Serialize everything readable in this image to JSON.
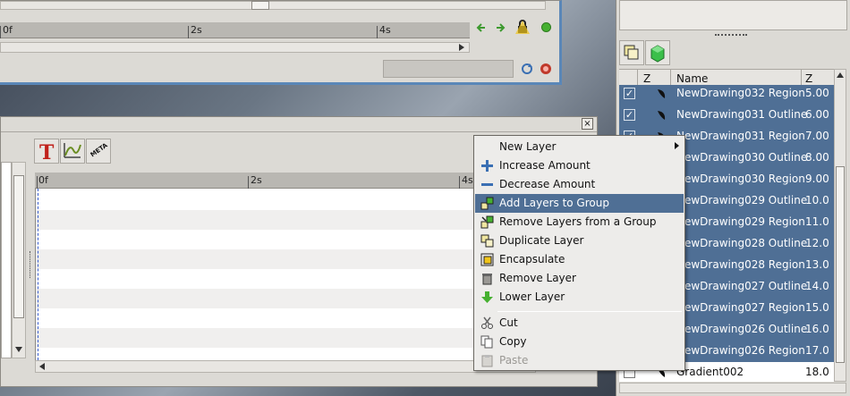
{
  "top_timetrack": {
    "ruler_labels": [
      "0f",
      "2s",
      "4s"
    ]
  },
  "params_timeline": {
    "ruler_labels": [
      "0f",
      "2s",
      "4s"
    ],
    "toolbar_meta_label": "META"
  },
  "layers_panel": {
    "columns": {
      "z": "Z",
      "name": "Name",
      "z_depth": "Z"
    },
    "rows": [
      {
        "name": "NewDrawing032 Region",
        "z": "5.00",
        "checked": true,
        "selected": true
      },
      {
        "name": "NewDrawing031 Outline",
        "z": "6.00",
        "checked": true,
        "selected": true
      },
      {
        "name": "NewDrawing031 Region",
        "z": "7.00",
        "checked": true,
        "selected": true
      },
      {
        "name": "NewDrawing030 Outline",
        "z": "8.00",
        "checked": true,
        "selected": true
      },
      {
        "name": "NewDrawing030 Region",
        "z": "9.00",
        "checked": true,
        "selected": true
      },
      {
        "name": "NewDrawing029 Outline",
        "z": "10.0",
        "checked": true,
        "selected": true
      },
      {
        "name": "NewDrawing029 Region",
        "z": "11.0",
        "checked": true,
        "selected": true
      },
      {
        "name": "NewDrawing028 Outline",
        "z": "12.0",
        "checked": true,
        "selected": true
      },
      {
        "name": "NewDrawing028 Region",
        "z": "13.0",
        "checked": true,
        "selected": true
      },
      {
        "name": "NewDrawing027 Outline",
        "z": "14.0",
        "checked": true,
        "selected": true
      },
      {
        "name": "NewDrawing027 Region",
        "z": "15.0",
        "checked": true,
        "selected": true
      },
      {
        "name": "NewDrawing026 Outline",
        "z": "16.0",
        "checked": true,
        "selected": true
      },
      {
        "name": "NewDrawing026 Region",
        "z": "17.0",
        "checked": true,
        "selected": true
      },
      {
        "name": "Gradient002",
        "z": "18.0",
        "checked": true,
        "selected": false
      }
    ]
  },
  "context_menu": {
    "items": [
      {
        "label": "New Layer",
        "icon": "none",
        "has_submenu": true
      },
      {
        "label": "Increase Amount",
        "icon": "plus-icon"
      },
      {
        "label": "Decrease Amount",
        "icon": "minus-icon"
      },
      {
        "label": "Add Layers to Group",
        "icon": "add-to-group-icon",
        "highlighted": true
      },
      {
        "label": "Remove Layers from a Group",
        "icon": "remove-from-group-icon"
      },
      {
        "label": "Duplicate Layer",
        "icon": "duplicate-icon"
      },
      {
        "label": "Encapsulate",
        "icon": "encapsulate-icon"
      },
      {
        "label": "Remove Layer",
        "icon": "trash-icon"
      },
      {
        "label": "Lower Layer",
        "icon": "arrow-down-icon"
      },
      {
        "label": "Cut",
        "icon": "scissors-icon"
      },
      {
        "label": "Copy",
        "icon": "copy-icon"
      },
      {
        "label": "Paste",
        "icon": "paste-icon",
        "disabled": true
      }
    ]
  },
  "colors": {
    "selection": "#4f6f95",
    "window_bg": "#dcdad5",
    "accent_border": "#5a87b8"
  }
}
